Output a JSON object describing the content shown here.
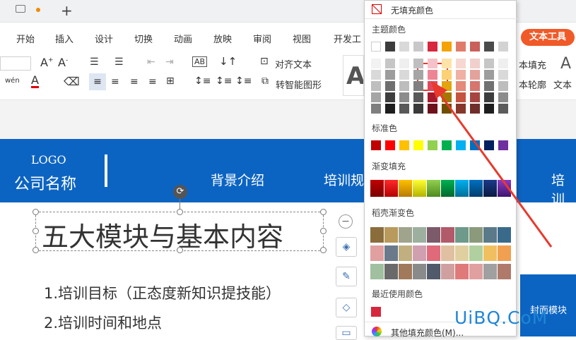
{
  "titlebar": {
    "add_tab": "+"
  },
  "ribbon_tabs": [
    "开始",
    "插入",
    "设计",
    "切换",
    "动画",
    "放映",
    "审阅",
    "视图",
    "开发工"
  ],
  "text_tool_tab": "文本工具",
  "ribbon": {
    "align_text": "对齐文本",
    "smart_shape": "转智能图形",
    "fill": "本填充",
    "outline": "本轮廓",
    "text": "文本",
    "wen": "wén"
  },
  "picker": {
    "no_fill": "无填充颜色",
    "theme_colors": "主题颜色",
    "standard_colors": "标准色",
    "gradient_fill": "渐变填充",
    "shell_gradient": "稻壳渐变色",
    "recent_colors": "最近使用颜色",
    "more_colors": "其他填充颜色(M)...",
    "theme_top": [
      "#ffffff",
      "#3c3c3c",
      "#d9d9d9",
      "#c8c8c8",
      "#d7263d",
      "#f4a300",
      "#e07b6a",
      "#c9605a",
      "#4a4a4a",
      "#d3d3d3"
    ],
    "theme_shades": [
      [
        "#f2f2f2",
        "#c6c6c6",
        "#efefef",
        "#bfbfbf",
        "#f6c2c9",
        "#fde3a8",
        "#f7d7d1",
        "#f0cfcc",
        "#c6c6c6",
        "#efefef"
      ],
      [
        "#d9d9d9",
        "#9d9d9d",
        "#d9d9d9",
        "#a5a5a5",
        "#ec8696",
        "#fcd074",
        "#f0b0a4",
        "#e3a29c",
        "#9d9d9d",
        "#d9d9d9"
      ],
      [
        "#bfbfbf",
        "#6f6f6f",
        "#bdbdbd",
        "#808080",
        "#e0485e",
        "#e2a50c",
        "#e58978",
        "#d6766d",
        "#717171",
        "#bdbdbd"
      ],
      [
        "#a5a5a5",
        "#3e3e3e",
        "#8c8c8c",
        "#595959",
        "#a51a2c",
        "#a67700",
        "#c6533d",
        "#a6453f",
        "#3d3d3d",
        "#8c8c8c"
      ],
      [
        "#7f7f7f",
        "#1e1e1e",
        "#595959",
        "#3a3a3a",
        "#6e111d",
        "#6e4f00",
        "#86372a",
        "#6f2e2a",
        "#1e1e1e",
        "#5c5c5c"
      ]
    ],
    "standard": [
      "#c00000",
      "#ff0000",
      "#ffc000",
      "#ffff00",
      "#92d050",
      "#00b050",
      "#00b0f0",
      "#0070c0",
      "#002060",
      "#7030a0"
    ],
    "gradients": [
      [
        "#c00000",
        "#7a0000"
      ],
      [
        "#ff2a2a",
        "#b30000"
      ],
      [
        "#ffc000",
        "#b87a00"
      ],
      [
        "#ffff33",
        "#b3b300"
      ],
      [
        "#92d050",
        "#4e8a1f"
      ],
      [
        "#00b050",
        "#00692e"
      ],
      [
        "#00b0f0",
        "#006f99"
      ],
      [
        "#0070c0",
        "#003e6e"
      ],
      [
        "#1a3a8a",
        "#0a1a40"
      ],
      [
        "#8a3ac4",
        "#3e1470"
      ]
    ],
    "shell_rows": [
      [
        "#8a6d3b",
        "#b99a5c",
        "#a0a48c",
        "#9db0a0",
        "#7d5a6a",
        "#b25a6a",
        "#6d9a8a",
        "#8a9a7a",
        "#5a7a8a",
        "#3a6a8a"
      ],
      [
        "#e0a0a0",
        "#6a7a8a",
        "#c0b080",
        "#d0a0b0",
        "#e06a7a",
        "#e0c0a0",
        "#e0d0a0",
        "#b0d0a0",
        "#f0c060",
        "#f0a050"
      ],
      [
        "#a0c0a0",
        "#6a6a6a",
        "#a07a5a",
        "#8a8a8a",
        "#505a6a",
        "#d0a0a0",
        "#e07a7a",
        "#e0a0a0",
        "#a0a0a0",
        "#b07a6a"
      ]
    ],
    "recent": [
      "#d7263d"
    ]
  },
  "slide": {
    "logo": "LOGO",
    "company": "公司名称",
    "nav1": "背景介绍",
    "nav2": "培训规",
    "nav3": "培训",
    "title": "五大模块与基本内容",
    "item1": "1.培训目标（正态度新知识提技能）",
    "item2": "2.培训时间和地点",
    "cover": "封面模块"
  },
  "watermark": "UiBQ.CoM"
}
